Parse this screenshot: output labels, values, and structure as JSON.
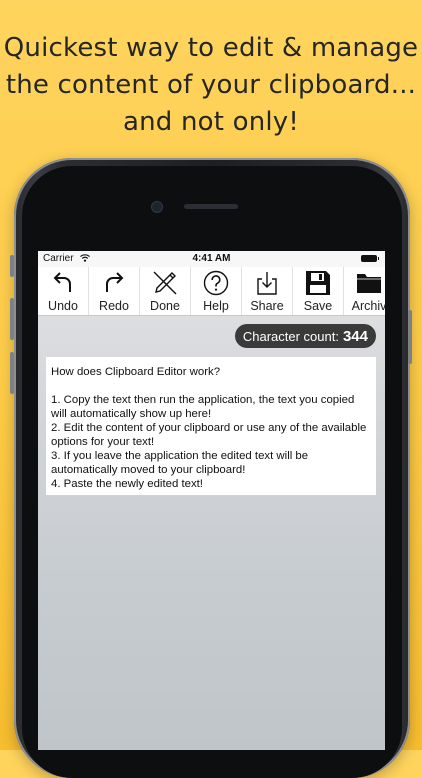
{
  "headline": {
    "line1": "Quickest way to edit & manage",
    "line2": "the content of your clipboard...",
    "line3": "and not only!"
  },
  "status_bar": {
    "carrier": "Carrier",
    "time": "4:41 AM"
  },
  "toolbar": {
    "items": [
      {
        "label": "Undo",
        "icon": "undo-icon"
      },
      {
        "label": "Redo",
        "icon": "redo-icon"
      },
      {
        "label": "Done",
        "icon": "pencil-crossed-icon"
      },
      {
        "label": "Help",
        "icon": "help-icon"
      },
      {
        "label": "Share",
        "icon": "share-icon"
      },
      {
        "label": "Save",
        "icon": "floppy-disk-icon"
      },
      {
        "label": "Archiv",
        "icon": "folder-icon"
      }
    ]
  },
  "character_count": {
    "label": "Character count:",
    "value": "344"
  },
  "editor": {
    "lines": [
      "How does Clipboard Editor work?",
      "",
      "1. Copy the text then run the application, the text you copied will automatically show up here!",
      "2. Edit the content of your clipboard or use any of the available options for your text!",
      "3. If you leave the application the edited text will be automatically moved to your clipboard!",
      "4. Paste the newly edited text!"
    ]
  },
  "colors": {
    "background": "#fcca45",
    "headline_text": "#262626",
    "badge": "#3a3a3a"
  }
}
